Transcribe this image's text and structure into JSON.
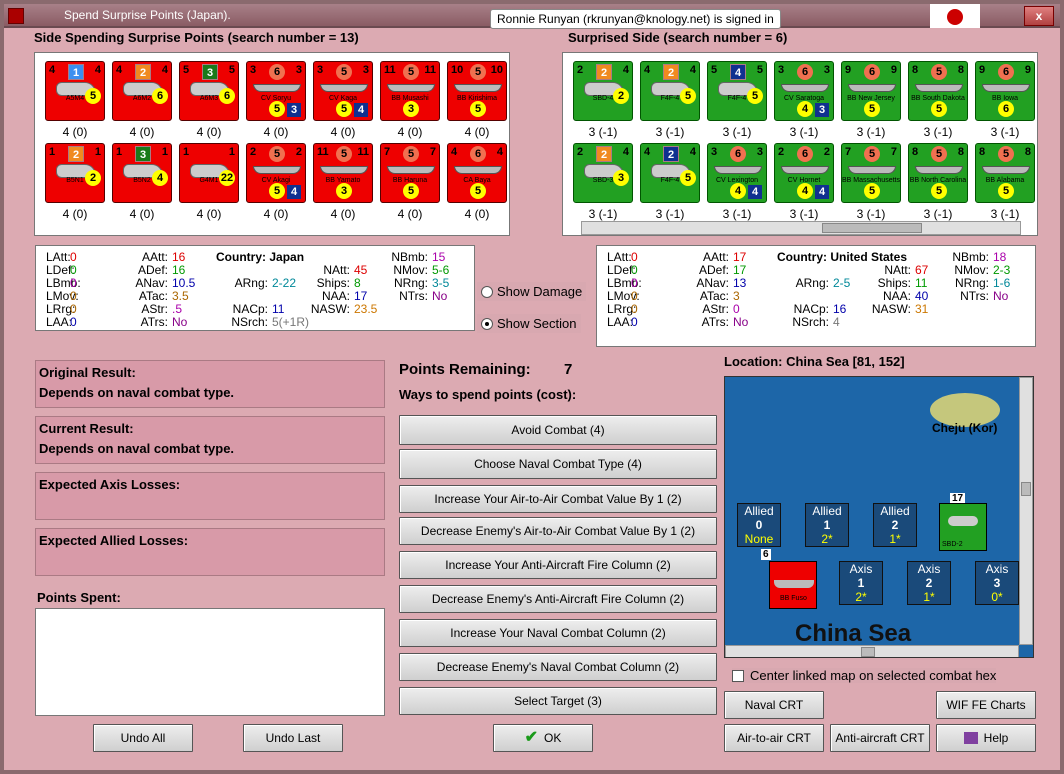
{
  "window": {
    "title": "Spend Surprise Points (Japan).",
    "signed_in": "Ronnie Runyan (rkrunyan@knology.net) is signed in"
  },
  "left_header": "Side Spending Surprise Points (search number = 13)",
  "right_header": "Surprised Side (search number = 6)",
  "left_units": [
    {
      "tl": "4",
      "tc": "1",
      "tr": "4",
      "name": "A5M4",
      "ym": "5",
      "count": "4 (0)"
    },
    {
      "tl": "4",
      "tc": "2",
      "tr": "4",
      "name": "A6M2",
      "ym": "6",
      "count": "4 (0)"
    },
    {
      "tl": "5",
      "tc": "3",
      "tr": "5",
      "name": "A6M3",
      "ym": "6",
      "count": "4 (0)"
    },
    {
      "tl": "3",
      "tc": "6",
      "tr": "3",
      "name": "CV Soryu",
      "bc": "5",
      "b2": "3",
      "count": "4 (0)"
    },
    {
      "tl": "3",
      "tc": "5",
      "tr": "3",
      "name": "CV Kaga",
      "bc": "5",
      "b2": "4",
      "count": "4 (0)"
    },
    {
      "tl": "11",
      "tc": "5",
      "tr": "11",
      "name": "BB Musashi",
      "bc": "3",
      "count": "4 (0)"
    },
    {
      "tl": "10",
      "tc": "5",
      "tr": "10",
      "name": "BB Kirishima",
      "bc": "5",
      "count": "4 (0)"
    },
    {
      "tl": "1",
      "tc": "2",
      "tr": "1",
      "name": "B5N1",
      "ym": "2",
      "count": "4 (0)"
    },
    {
      "tl": "1",
      "tc": "3",
      "tr": "1",
      "name": "B5N2",
      "ym": "4",
      "count": "4 (0)"
    },
    {
      "tl": "1",
      "tc": "",
      "tr": "1",
      "name": "G4M1",
      "ym": "22",
      "count": "4 (0)"
    },
    {
      "tl": "2",
      "tc": "5",
      "tr": "2",
      "name": "CV Akagi",
      "bc": "5",
      "b2": "4",
      "count": "4 (0)"
    },
    {
      "tl": "11",
      "tc": "5",
      "tr": "11",
      "name": "BB Yamato",
      "bc": "3",
      "count": "4 (0)"
    },
    {
      "tl": "7",
      "tc": "5",
      "tr": "7",
      "name": "BB Haruna",
      "bc": "5",
      "count": "4 (0)"
    },
    {
      "tl": "4",
      "tc": "6",
      "tr": "4",
      "name": "CA Baya",
      "bc": "5",
      "count": "4 (0)"
    }
  ],
  "right_units": [
    {
      "tl": "2",
      "tc": "2",
      "tr": "4",
      "name": "SBD-4",
      "ym": "2",
      "count": "3 (-1)"
    },
    {
      "tl": "4",
      "tc": "2",
      "tr": "4",
      "name": "F4F-4",
      "ym": "5",
      "count": "3 (-1)"
    },
    {
      "tl": "5",
      "tc": "4",
      "tr": "5",
      "name": "F4F-4",
      "ym": "5",
      "count": "3 (-1)"
    },
    {
      "tl": "3",
      "tc": "6",
      "tr": "3",
      "name": "CV Saratoga",
      "bc": "4",
      "b2": "3",
      "count": "3 (-1)"
    },
    {
      "tl": "9",
      "tc": "6",
      "tr": "9",
      "name": "BB New Jersey",
      "bc": "5",
      "count": "3 (-1)"
    },
    {
      "tl": "8",
      "tc": "5",
      "tr": "8",
      "name": "BB South Dakota",
      "bc": "5",
      "count": "3 (-1)"
    },
    {
      "tl": "9",
      "tc": "6",
      "tr": "9",
      "name": "BB Iowa",
      "bc": "6",
      "count": "3 (-1)"
    },
    {
      "tl": "2",
      "tc": "2",
      "tr": "4",
      "name": "SBD-3",
      "ym": "3",
      "count": "3 (-1)"
    },
    {
      "tl": "4",
      "tc": "2",
      "tr": "4",
      "name": "F4F-4",
      "ym": "5",
      "count": "3 (-1)"
    },
    {
      "tl": "3",
      "tc": "6",
      "tr": "3",
      "name": "CV Lexington",
      "bc": "4",
      "b2": "4",
      "count": "3 (-1)"
    },
    {
      "tl": "2",
      "tc": "6",
      "tr": "2",
      "name": "CV Hornet",
      "bc": "4",
      "b2": "4",
      "count": "3 (-1)"
    },
    {
      "tl": "7",
      "tc": "5",
      "tr": "7",
      "name": "BB Massachusetts",
      "bc": "5",
      "count": "3 (-1)"
    },
    {
      "tl": "8",
      "tc": "5",
      "tr": "8",
      "name": "BB North Carolina",
      "bc": "5",
      "count": "3 (-1)"
    },
    {
      "tl": "8",
      "tc": "5",
      "tr": "8",
      "name": "BB Alabama",
      "bc": "5",
      "count": "3 (-1)"
    }
  ],
  "left_stats": {
    "LAtt": "0",
    "LDef": "0",
    "LBmb": "0",
    "LMov": "0",
    "LRrg": "0",
    "LAA": "0",
    "AAtt": "16",
    "ADef": "16",
    "ANav": "10.5",
    "ATac": "3.5",
    "AStr": ".5",
    "ATrs": "No",
    "country_label": "Country:",
    "country": "Japan",
    "ARng": "2-22",
    "NAtt": "45",
    "Ships": "8",
    "NAA": "17",
    "NASW": "23.5",
    "NACp": "11",
    "NSrch": "5(+1R)",
    "NBmb": "15",
    "NMov": "5-6",
    "NRng": "3-5",
    "NTrs": "No"
  },
  "right_stats": {
    "LAtt": "0",
    "LDef": "0",
    "LBmb": "0",
    "LMov": "0",
    "LRrg": "0",
    "LAA": "0",
    "AAtt": "17",
    "ADef": "17",
    "ANav": "13",
    "ATac": "3",
    "AStr": "0",
    "ATrs": "No",
    "country_label": "Country:",
    "country": "United States",
    "ARng": "2-5",
    "NAtt": "67",
    "Ships": "11",
    "NAA": "40",
    "NASW": "31",
    "NACp": "16",
    "NSrch": "4",
    "NBmb": "18",
    "NMov": "2-3",
    "NRng": "1-6",
    "NTrs": "No"
  },
  "radio": {
    "show_damage": "Show Damage",
    "show_section": "Show Section"
  },
  "results": {
    "original_label": "Original Result:",
    "original_value": "Depends on naval combat type.",
    "current_label": "Current Result:",
    "current_value": "Depends on naval combat type.",
    "axis_losses": "Expected Axis Losses:",
    "allied_losses": "Expected Allied Losses:",
    "points_spent": "Points Spent:"
  },
  "points": {
    "label": "Points Remaining:",
    "value": "7",
    "ways": "Ways to spend points (cost):"
  },
  "actions": [
    "Avoid Combat (4)",
    "Choose Naval Combat Type (4)",
    "Increase Your Air-to-Air Combat Value By 1 (2)",
    "Decrease Enemy's Air-to-Air Combat Value By 1 (2)",
    "Increase Your Anti-Aircraft Fire Column (2)",
    "Decrease Enemy's Anti-Aircraft Fire Column (2)",
    "Increase Your Naval Combat Column (2)",
    "Decrease Enemy's Naval Combat Column (2)",
    "Select Target (3)"
  ],
  "buttons": {
    "undo_all": "Undo All",
    "undo_last": "Undo Last",
    "ok": "OK",
    "naval_crt": "Naval CRT",
    "wif_charts": "WIF FE Charts",
    "air_crt": "Air-to-air CRT",
    "aa_crt": "Anti-aircraft CRT",
    "help": "Help"
  },
  "location": "Location: China Sea [81, 152]",
  "map": {
    "island": "Cheju (Kor)",
    "sea": "China Sea",
    "center_label": "Center linked map on selected combat hex",
    "allied": [
      {
        "label": "Allied",
        "num": "0",
        "sub": "None"
      },
      {
        "label": "Allied",
        "num": "1",
        "sub": "2*"
      },
      {
        "label": "Allied",
        "num": "2",
        "sub": "1*"
      }
    ],
    "axis": [
      {
        "label": "Axis",
        "num": "1",
        "sub": "2*"
      },
      {
        "label": "Axis",
        "num": "2",
        "sub": "1*"
      },
      {
        "label": "Axis",
        "num": "3",
        "sub": "0*"
      }
    ],
    "stack_allied": "17",
    "stack_axis": "6",
    "unit_allied_name": "SBD-2",
    "unit_axis_name": "BB Fuso"
  }
}
